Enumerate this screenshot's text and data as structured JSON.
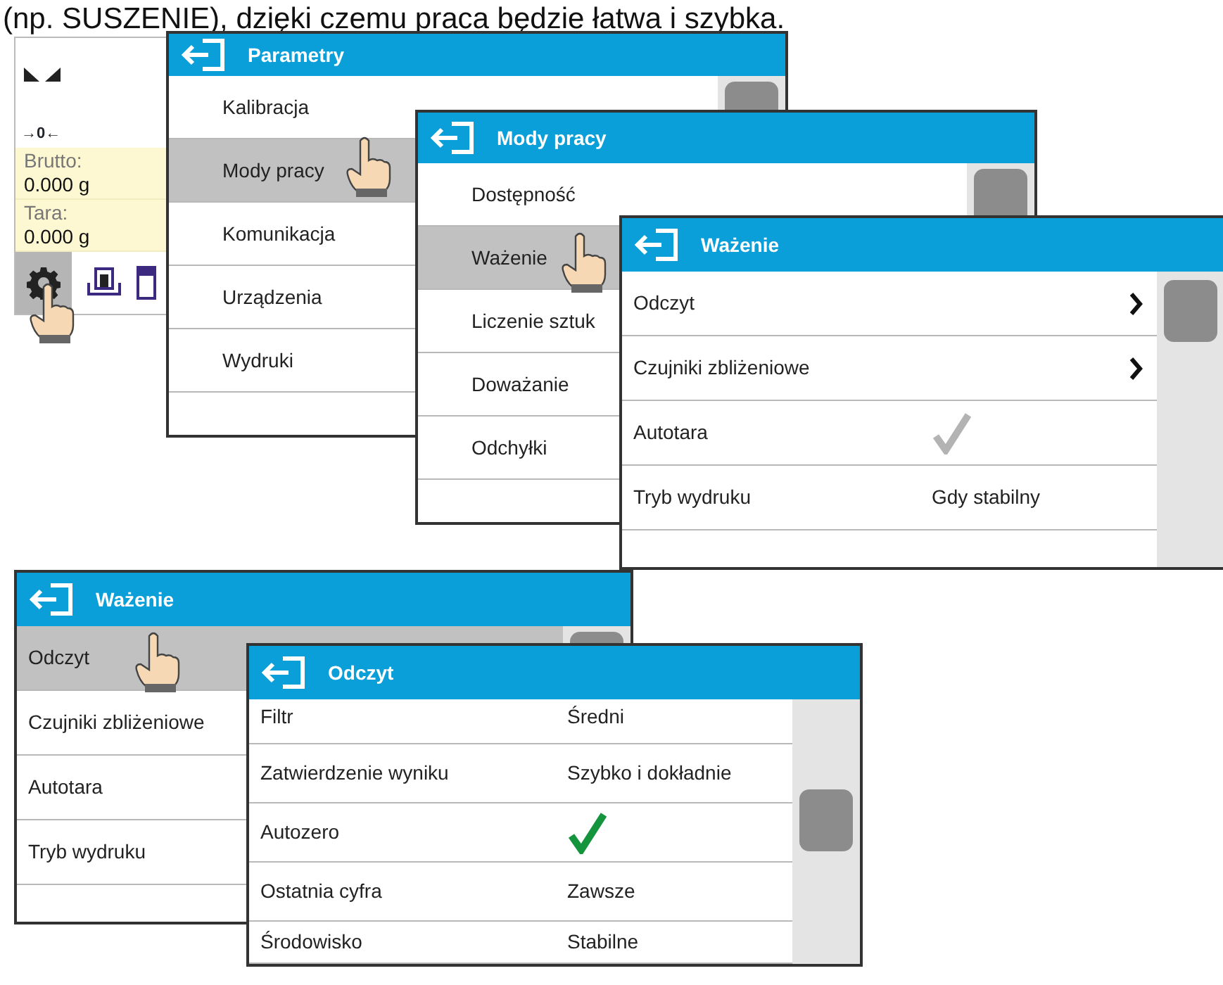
{
  "caption": "(np. SUSZENIE), dzięki czemu praca będzie łatwa i szybka.",
  "home": {
    "zero_indicator": "→0←",
    "readings": [
      {
        "label": "Brutto:",
        "value": "0.000 g"
      },
      {
        "label": "Tara:",
        "value": "0.000 g"
      }
    ]
  },
  "windows": [
    {
      "title": "Parametry",
      "rows": [
        {
          "label": "Kalibracja",
          "kind": "plain",
          "selected": false
        },
        {
          "label": "Mody pracy",
          "kind": "plain",
          "selected": true
        },
        {
          "label": "Komunikacja",
          "kind": "plain",
          "selected": false
        },
        {
          "label": "Urządzenia",
          "kind": "plain",
          "selected": false
        },
        {
          "label": "Wydruki",
          "kind": "plain",
          "selected": false
        }
      ]
    },
    {
      "title": "Mody pracy",
      "rows": [
        {
          "label": "Dostępność",
          "kind": "plain",
          "selected": false
        },
        {
          "label": "Ważenie",
          "kind": "plain",
          "selected": true
        },
        {
          "label": "Liczenie sztuk",
          "kind": "plain",
          "selected": false
        },
        {
          "label": "Doważanie",
          "kind": "plain",
          "selected": false
        },
        {
          "label": "Odchyłki",
          "kind": "plain",
          "selected": false
        }
      ]
    },
    {
      "title": "Ważenie",
      "rows": [
        {
          "label": "Odczyt",
          "kind": "submenu",
          "selected": false
        },
        {
          "label": "Czujniki zbliżeniowe",
          "kind": "submenu",
          "selected": false
        },
        {
          "label": "Autotara",
          "kind": "check",
          "checked": false,
          "selected": false
        },
        {
          "label": "Tryb wydruku",
          "kind": "value",
          "value": "Gdy stabilny",
          "selected": false
        }
      ]
    },
    {
      "title": "Ważenie",
      "rows": [
        {
          "label": "Odczyt",
          "kind": "plain",
          "selected": true
        },
        {
          "label": "Czujniki zbliżeniowe",
          "kind": "plain",
          "selected": false
        },
        {
          "label": "Autotara",
          "kind": "plain",
          "selected": false
        },
        {
          "label": "Tryb wydruku",
          "kind": "plain",
          "selected": false
        }
      ]
    },
    {
      "title": "Odczyt",
      "rows": [
        {
          "label": "Filtr",
          "kind": "value",
          "value": "Średni",
          "selected": false
        },
        {
          "label": "Zatwierdzenie wyniku",
          "kind": "value",
          "value": "Szybko i dokładnie",
          "selected": false
        },
        {
          "label": "Autozero",
          "kind": "check",
          "checked": true,
          "selected": false
        },
        {
          "label": "Ostatnia cyfra",
          "kind": "value",
          "value": "Zawsze",
          "selected": false
        },
        {
          "label": "Środowisko",
          "kind": "value",
          "value": "Stabilne",
          "selected": false
        }
      ]
    }
  ]
}
